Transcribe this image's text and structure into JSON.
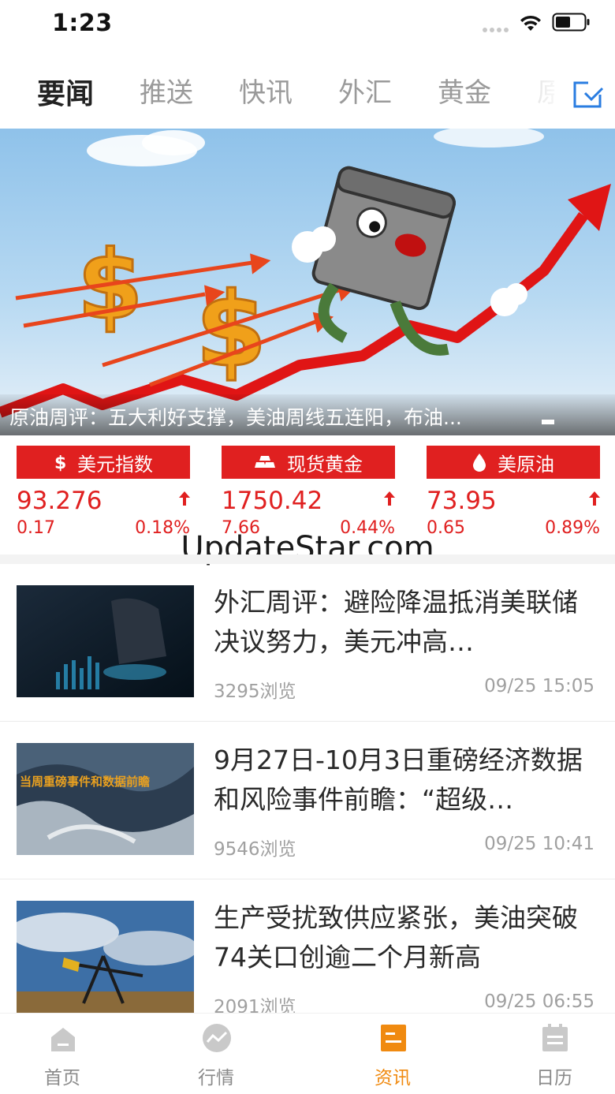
{
  "status": {
    "time": "1:23"
  },
  "tabs": [
    {
      "label": "要闻",
      "active": true
    },
    {
      "label": "推送"
    },
    {
      "label": "快讯"
    },
    {
      "label": "外汇"
    },
    {
      "label": "黄金"
    },
    {
      "label": "原"
    }
  ],
  "banner": {
    "caption": "原油周评：五大利好支撑，美油周线五连阳，布油..."
  },
  "quotes": [
    {
      "icon": "dollar-icon",
      "name": "美元指数",
      "price": "93.276",
      "change": "0.17",
      "percent": "0.18%",
      "direction": "up"
    },
    {
      "icon": "gold-bars-icon",
      "name": "现货黄金",
      "price": "1750.42",
      "change": "7.66",
      "percent": "0.44%",
      "direction": "up"
    },
    {
      "icon": "oil-drop-icon",
      "name": "美原油",
      "price": "73.95",
      "change": "0.65",
      "percent": "0.89%",
      "direction": "up"
    }
  ],
  "watermark": "UpdateStar.com",
  "news": [
    {
      "title": "外汇周评：避险降温抵消美联储决议努力，美元冲高…",
      "views": "3295浏览",
      "time": "09/25 15:05"
    },
    {
      "title": "9月27日-10月3日重磅经济数据和风险事件前瞻：“超级…",
      "views": "9546浏览",
      "time": "09/25 10:41",
      "thumb_text": "当周重磅事件和数据前瞻"
    },
    {
      "title": "生产受扰致供应紧张，美油突破74关口创逾二个月新高",
      "views": "2091浏览",
      "time": "09/25 06:55"
    }
  ],
  "bottom_nav": [
    {
      "label": "首页",
      "icon": "home-icon"
    },
    {
      "label": "行情",
      "icon": "chart-icon"
    },
    {
      "label": "资讯",
      "icon": "news-icon",
      "active": true
    },
    {
      "label": "日历",
      "icon": "calendar-icon"
    }
  ],
  "colors": {
    "accent_red": "#e02020",
    "active_orange": "#f08a10",
    "muted_gray": "#a0a0a0"
  }
}
